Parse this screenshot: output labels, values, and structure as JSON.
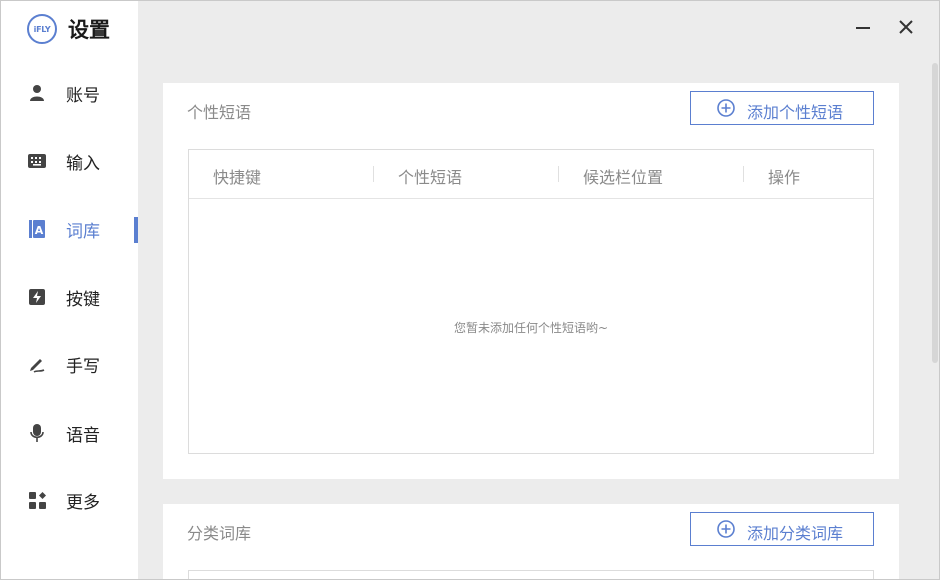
{
  "app": {
    "logo_text": "iFLY",
    "title": "设置"
  },
  "sidebar": {
    "items": [
      {
        "label": "账号",
        "icon": "user-icon"
      },
      {
        "label": "输入",
        "icon": "keyboard-icon"
      },
      {
        "label": "词库",
        "icon": "lexicon-icon",
        "active": true
      },
      {
        "label": "按键",
        "icon": "key-icon"
      },
      {
        "label": "手写",
        "icon": "pen-icon"
      },
      {
        "label": "语音",
        "icon": "mic-icon"
      },
      {
        "label": "更多",
        "icon": "more-grid-icon"
      }
    ]
  },
  "window_controls": {
    "minimize_icon": "minimize-icon",
    "close_icon": "close-icon"
  },
  "custom_phrases": {
    "title": "个性短语",
    "add_button": "添加个性短语",
    "columns": [
      "快捷键",
      "个性短语",
      "候选栏位置",
      "操作"
    ],
    "empty_message": "您暂未添加任何个性短语哟~"
  },
  "category_lexicon": {
    "title": "分类词库",
    "add_button": "添加分类词库"
  },
  "colors": {
    "accent": "#5b7fd0",
    "text_muted": "#8a8a8a",
    "background": "#ececec"
  }
}
